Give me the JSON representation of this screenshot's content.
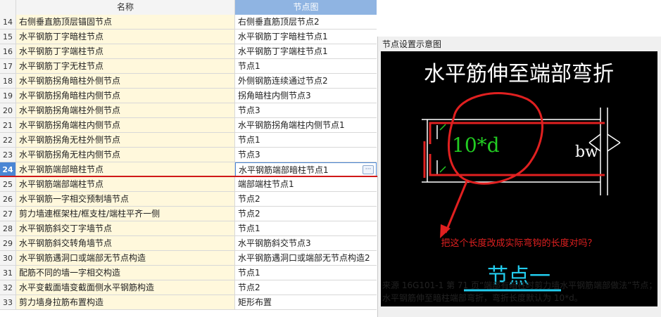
{
  "table": {
    "headers": {
      "name": "名称",
      "node": "节点图"
    },
    "selected_row": "24",
    "rows": [
      {
        "num": "14",
        "name": "右侧垂直筋顶层锚固节点",
        "node": "右侧垂直筋顶层节点2"
      },
      {
        "num": "15",
        "name": "水平钢筋丁字暗柱节点",
        "node": "水平钢筋丁字暗柱节点1"
      },
      {
        "num": "16",
        "name": "水平钢筋丁字端柱节点",
        "node": "水平钢筋丁字端柱节点1"
      },
      {
        "num": "17",
        "name": "水平钢筋丁字无柱节点",
        "node": "节点1"
      },
      {
        "num": "18",
        "name": "水平钢筋拐角暗柱外侧节点",
        "node": "外侧钢筋连续通过节点2"
      },
      {
        "num": "19",
        "name": "水平钢筋拐角暗柱内侧节点",
        "node": "拐角暗柱内侧节点3"
      },
      {
        "num": "20",
        "name": "水平钢筋拐角端柱外侧节点",
        "node": "节点3"
      },
      {
        "num": "21",
        "name": "水平钢筋拐角端柱内侧节点",
        "node": "水平钢筋拐角端柱内侧节点1"
      },
      {
        "num": "22",
        "name": "水平钢筋拐角无柱外侧节点",
        "node": "节点1"
      },
      {
        "num": "23",
        "name": "水平钢筋拐角无柱内侧节点",
        "node": "节点3"
      },
      {
        "num": "24",
        "name": "水平钢筋端部暗柱节点",
        "node": "水平钢筋端部暗柱节点1"
      },
      {
        "num": "25",
        "name": "水平钢筋端部端柱节点",
        "node": "端部端柱节点1"
      },
      {
        "num": "26",
        "name": "水平钢筋一字相交预制墙节点",
        "node": "节点2"
      },
      {
        "num": "27",
        "name": "剪力墙連框架柱/框支柱/端柱平齐一侧",
        "node": "节点2"
      },
      {
        "num": "28",
        "name": "水平钢筋斜交丁字墙节点",
        "node": "节点1"
      },
      {
        "num": "29",
        "name": "水平钢筋斜交转角墙节点",
        "node": "水平钢筋斜交节点3"
      },
      {
        "num": "30",
        "name": "水平钢筋遇洞口或端部无节点构造",
        "node": "水平钢筋遇洞口或端部无节点构造2"
      },
      {
        "num": "31",
        "name": "配筋不同的墙一字相交构造",
        "node": "节点1"
      },
      {
        "num": "32",
        "name": "水平变截面墙变截面侧水平钢筋构造",
        "node": "节点2"
      },
      {
        "num": "33",
        "name": "剪力墙身拉筋布置构造",
        "node": "矩形布置"
      }
    ]
  },
  "panel": {
    "title": "节点设置示意图",
    "diagram": {
      "heading": "水平筋伸至端部弯折",
      "dim_label": "10*d",
      "bw_label": "bw",
      "question": "把这个长度改成实际弯钩的长度对吗？",
      "node_name": "节点一"
    },
    "caption": "来源 16G101-1 第 71 页“端部有暗柱时剪力墙水平钢筋端部做法”节点；水平钢筋伸至暗柱端部弯折，弯折长度默认为 10*d。"
  },
  "colors": {
    "header_node_bg": "#8fb4e2",
    "name_cell_bg": "#fff8dc",
    "selected_num_bg": "#4a86d4",
    "annotation_red": "#e02020",
    "dim_green": "#22cc22",
    "node_name_cyan": "#22ccee"
  },
  "icons": {
    "ellipsis": "ellipsis-button-icon"
  }
}
